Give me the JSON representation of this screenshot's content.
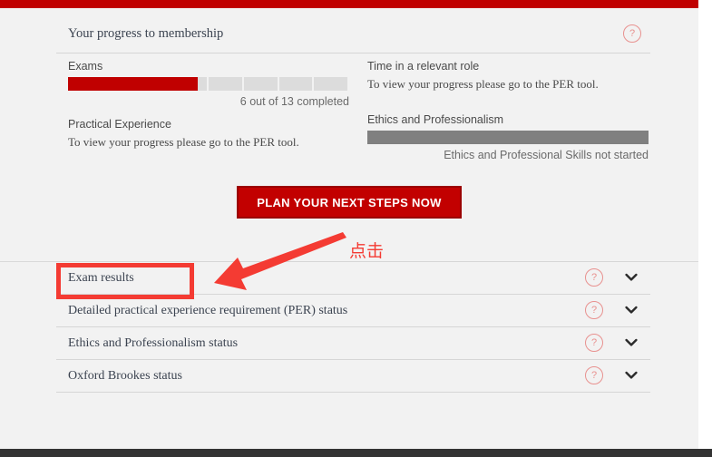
{
  "theme": {
    "brand_red": "#c00000",
    "annotation_red": "#f43b33",
    "help_icon_red": "#e8918f",
    "page_bg": "#f2f2f2",
    "bar_empty_grey": "#dcdcdc",
    "bar_solid_grey": "#808080"
  },
  "progress_panel": {
    "title": "Your progress to membership",
    "help_icon": "question-mark-icon",
    "help_label": "?",
    "exams": {
      "label": "Exams",
      "completed": 6,
      "total": 13,
      "caption": "6 out of 13 completed",
      "segments": 8,
      "filled_fraction": 0.46
    },
    "practical_experience": {
      "label": "Practical Experience",
      "description": "To view your progress please go to the PER tool."
    },
    "time_in_role": {
      "label": "Time in a relevant role",
      "description": "To view your progress please go to the PER tool."
    },
    "ethics": {
      "label": "Ethics and Professionalism",
      "caption": "Ethics and Professional Skills not started",
      "filled_fraction": 0
    }
  },
  "cta": {
    "label": "PLAN YOUR NEXT STEPS NOW"
  },
  "accordion": {
    "rows": [
      {
        "label": "Exam results",
        "help_label": "?",
        "help_icon": "question-mark-icon",
        "chevron_icon": "chevron-down-icon",
        "highlighted": true
      },
      {
        "label": "Detailed practical experience requirement (PER) status",
        "help_label": "?",
        "help_icon": "question-mark-icon",
        "chevron_icon": "chevron-down-icon",
        "highlighted": false
      },
      {
        "label": "Ethics and Professionalism status",
        "help_label": "?",
        "help_icon": "question-mark-icon",
        "chevron_icon": "chevron-down-icon",
        "highlighted": false
      },
      {
        "label": "Oxford Brookes status",
        "help_label": "?",
        "help_icon": "question-mark-icon",
        "chevron_icon": "chevron-down-icon",
        "highlighted": false
      }
    ]
  },
  "annotations": {
    "callout_text": "点击",
    "arrow_icon": "arrow-pointing-left-icon",
    "highlight_target": "Exam results"
  }
}
